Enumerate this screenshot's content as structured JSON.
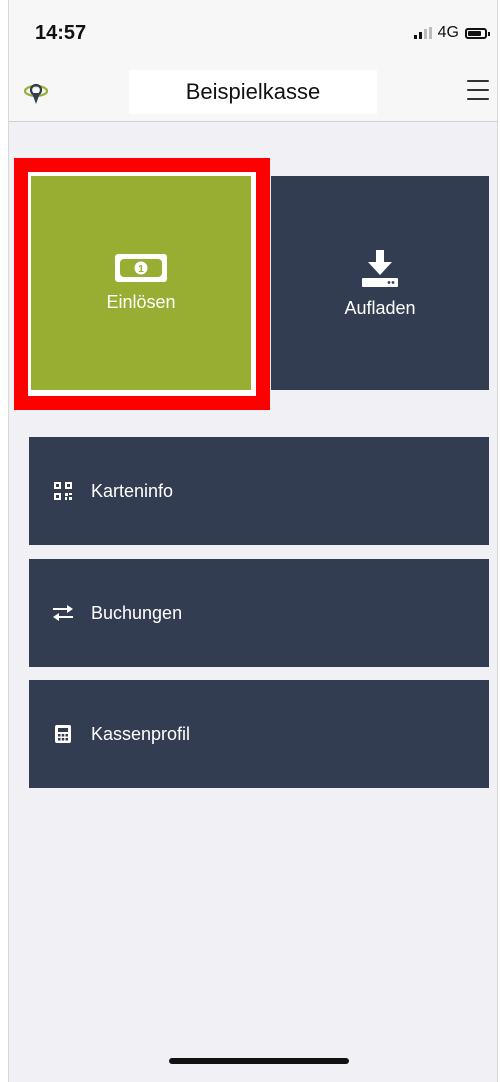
{
  "status_bar": {
    "time": "14:57",
    "network": "4G"
  },
  "navbar": {
    "title": "Beispielkasse",
    "logo_icon": "location-pin-logo-icon",
    "menu_icon": "hamburger-menu-icon"
  },
  "tiles": [
    {
      "label": "Einlösen",
      "icon": "banknote-icon",
      "color": "#98ae32",
      "highlighted": true
    },
    {
      "label": "Aufladen",
      "icon": "download-icon",
      "color": "#333d51",
      "highlighted": false
    }
  ],
  "menu_items": [
    {
      "label": "Karteninfo",
      "icon": "qr-code-icon"
    },
    {
      "label": "Buchungen",
      "icon": "transfer-arrows-icon"
    },
    {
      "label": "Kassenprofil",
      "icon": "calculator-icon"
    }
  ],
  "colors": {
    "tile_dark": "#333d51",
    "tile_green": "#98ae32",
    "highlight_border": "#ff0000",
    "background": "#f1f0f5"
  }
}
